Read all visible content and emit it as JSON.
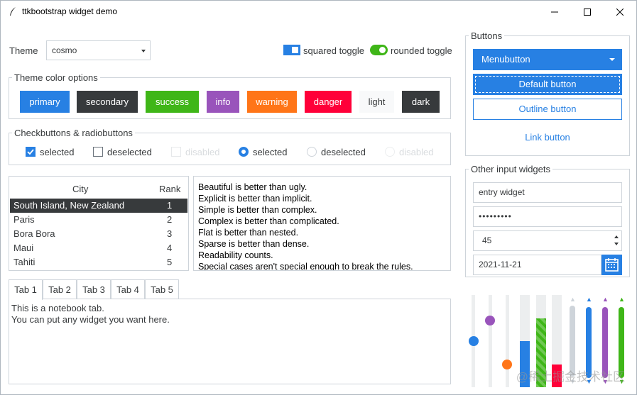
{
  "window": {
    "title": "ttkbootstrap widget demo"
  },
  "theme": {
    "label": "Theme",
    "value": "cosmo"
  },
  "toggles": {
    "squared": "squared toggle",
    "rounded": "rounded toggle"
  },
  "color_options": {
    "title": "Theme color options",
    "buttons": [
      {
        "label": "primary",
        "bg": "#2780e3",
        "fg": "#ffffff"
      },
      {
        "label": "secondary",
        "bg": "#373a3c",
        "fg": "#ffffff"
      },
      {
        "label": "success",
        "bg": "#3fb618",
        "fg": "#ffffff"
      },
      {
        "label": "info",
        "bg": "#9954bb",
        "fg": "#ffffff"
      },
      {
        "label": "warning",
        "bg": "#ff7518",
        "fg": "#ffffff"
      },
      {
        "label": "danger",
        "bg": "#ff0039",
        "fg": "#ffffff"
      },
      {
        "label": "light",
        "bg": "#f8f9fa",
        "fg": "#373a3c"
      },
      {
        "label": "dark",
        "bg": "#373a3c",
        "fg": "#ffffff"
      }
    ]
  },
  "checks_radios": {
    "title": "Checkbuttons & radiobuttons",
    "items": [
      "selected",
      "deselected",
      "disabled",
      "selected",
      "deselected",
      "disabled"
    ]
  },
  "table": {
    "columns": [
      "City",
      "Rank"
    ],
    "rows": [
      {
        "city": "South Island, New Zealand",
        "rank": "1"
      },
      {
        "city": "Paris",
        "rank": "2"
      },
      {
        "city": "Bora Bora",
        "rank": "3"
      },
      {
        "city": "Maui",
        "rank": "4"
      },
      {
        "city": "Tahiti",
        "rank": "5"
      }
    ]
  },
  "text_lines": [
    "Beautiful is better than ugly.",
    "Explicit is better than implicit.",
    "Simple is better than complex.",
    "Complex is better than complicated.",
    "Flat is better than nested.",
    "Sparse is better than dense.",
    "Readability counts.",
    "Special cases aren't special enough to break the rules."
  ],
  "notebook": {
    "tabs": [
      "Tab 1",
      "Tab 2",
      "Tab 3",
      "Tab 4",
      "Tab 5"
    ],
    "content": [
      "This is a notebook tab.",
      "You can put any widget you want here."
    ]
  },
  "buttons_panel": {
    "title": "Buttons",
    "menubutton": "Menubutton",
    "default": "Default button",
    "outline": "Outline button",
    "link": "Link button"
  },
  "inputs_panel": {
    "title": "Other input widgets",
    "entry": "entry widget",
    "password": "•••••••••",
    "spinbox": "45",
    "date": "2021-11-21"
  },
  "levels": {
    "scales": [
      0.5,
      0.72,
      0.25
    ],
    "progress": [
      0.5,
      0.75,
      0.25
    ],
    "progress_colors": [
      "#2780e3",
      "#3fb618",
      "#ff0039"
    ]
  },
  "watermark": "@稀土掘金技术社区",
  "colors": {
    "primary": "#2780e3",
    "success": "#3fb618",
    "info": "#9954bb",
    "warning": "#ff7518",
    "danger": "#ff0039",
    "secondary": "#373a3c",
    "border": "#ced4da"
  }
}
